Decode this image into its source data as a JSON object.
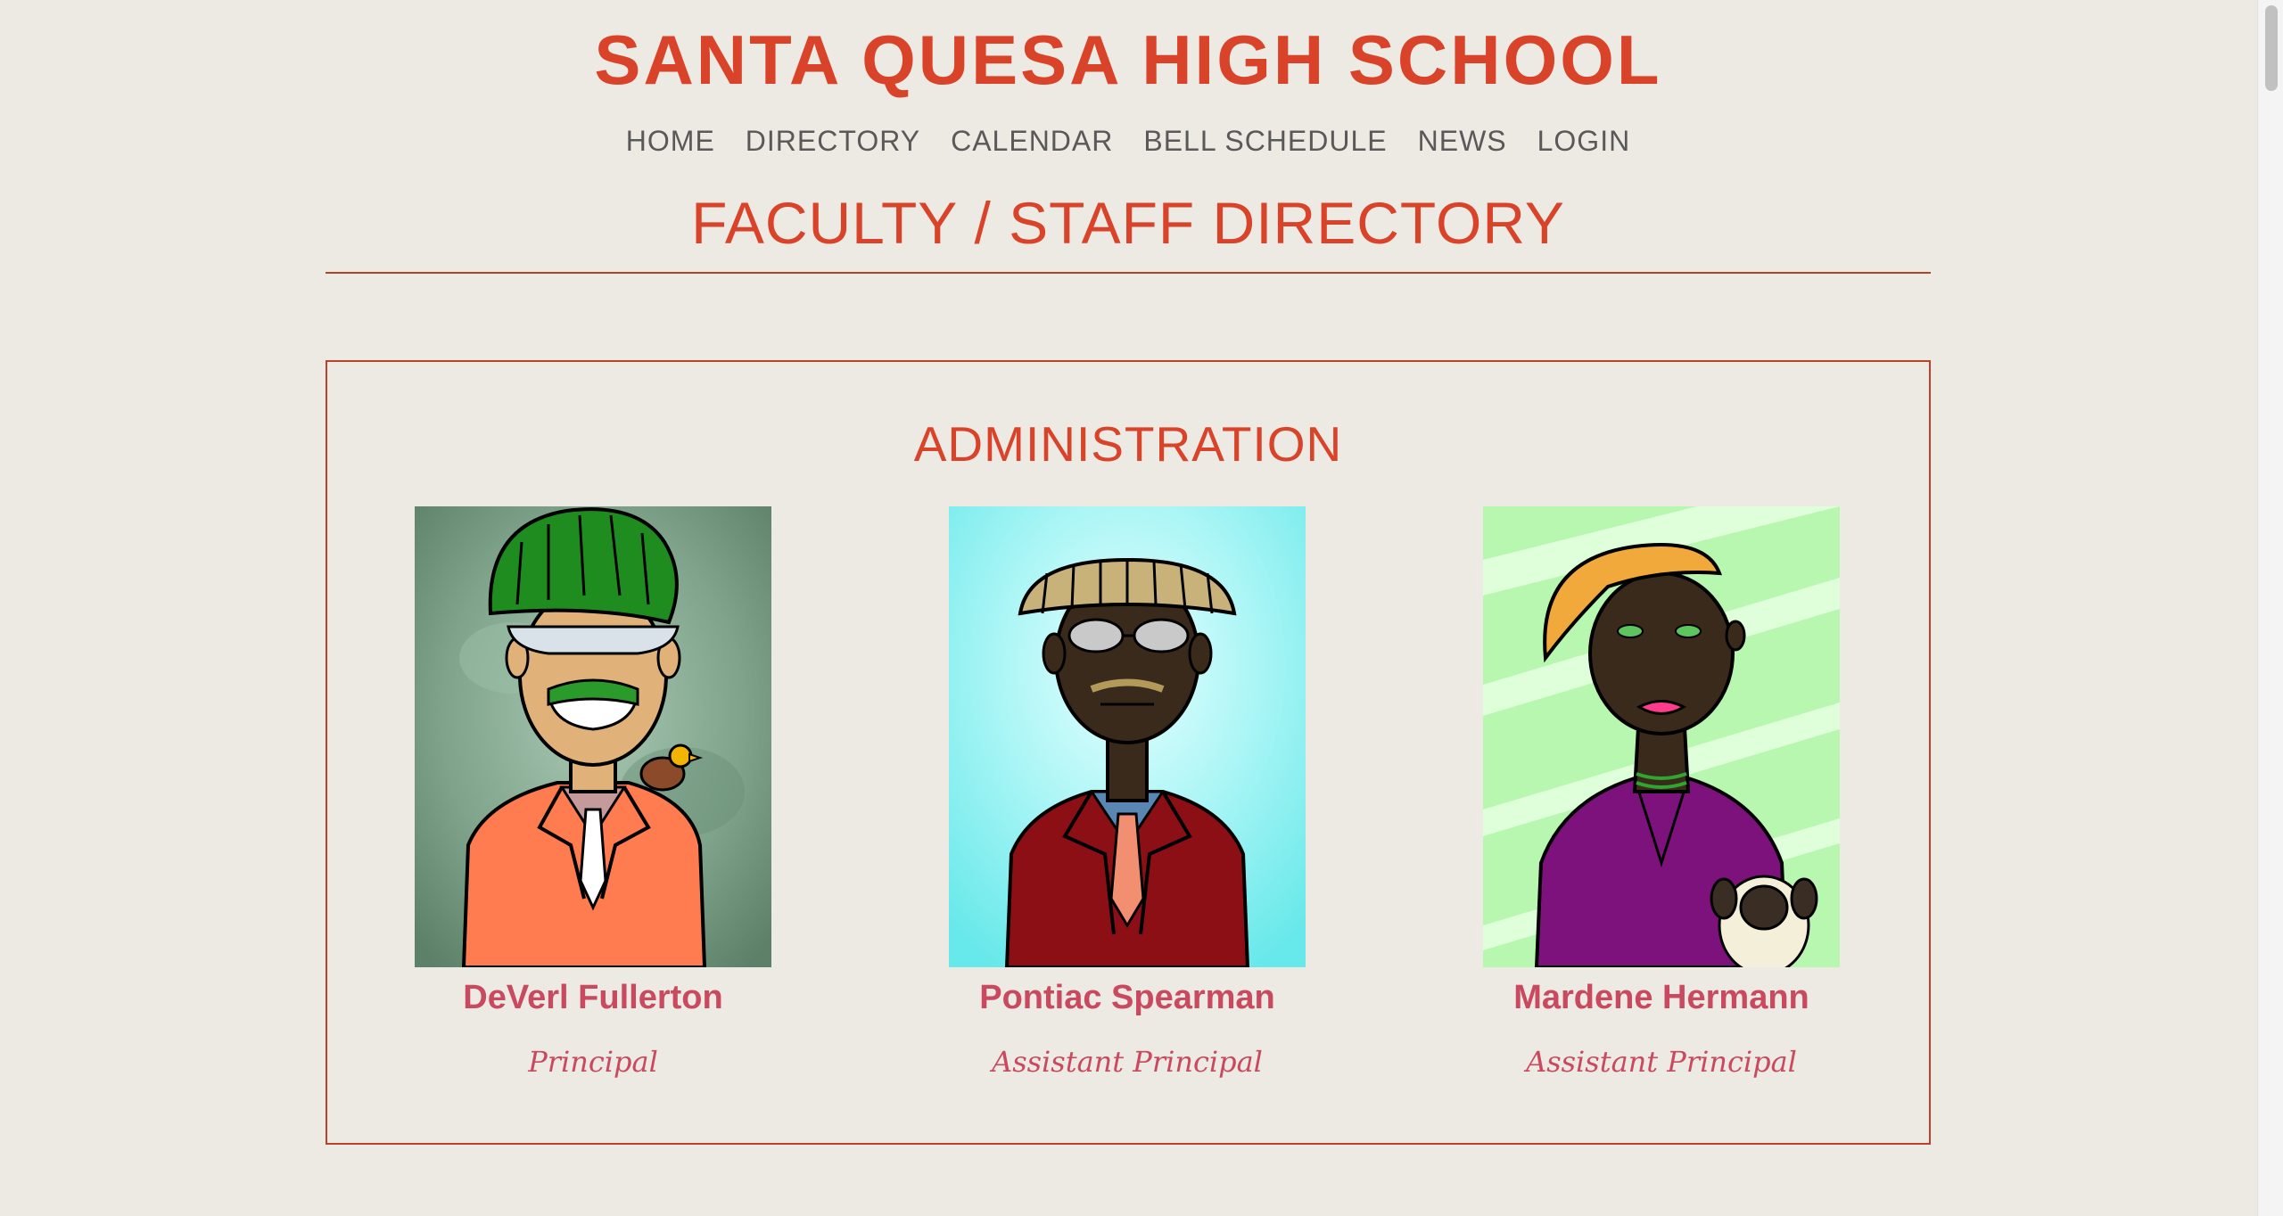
{
  "site": {
    "title": "SANTA QUESA HIGH SCHOOL"
  },
  "nav": {
    "items": [
      {
        "label": "HOME"
      },
      {
        "label": "DIRECTORY"
      },
      {
        "label": "CALENDAR"
      },
      {
        "label": "BELL SCHEDULE"
      },
      {
        "label": "NEWS"
      },
      {
        "label": "LOGIN"
      }
    ]
  },
  "page": {
    "title": "FACULTY / STAFF DIRECTORY"
  },
  "administration": {
    "title": "ADMINISTRATION",
    "staff": [
      {
        "name": "DeVerl Fullerton",
        "role": "Principal"
      },
      {
        "name": "Pontiac Spearman",
        "role": "Assistant Principal"
      },
      {
        "name": "Mardene Hermann",
        "role": "Assistant Principal"
      }
    ]
  },
  "colors": {
    "accent": "#d8432a",
    "name_text": "#c9495e",
    "background": "#ede9e3"
  }
}
